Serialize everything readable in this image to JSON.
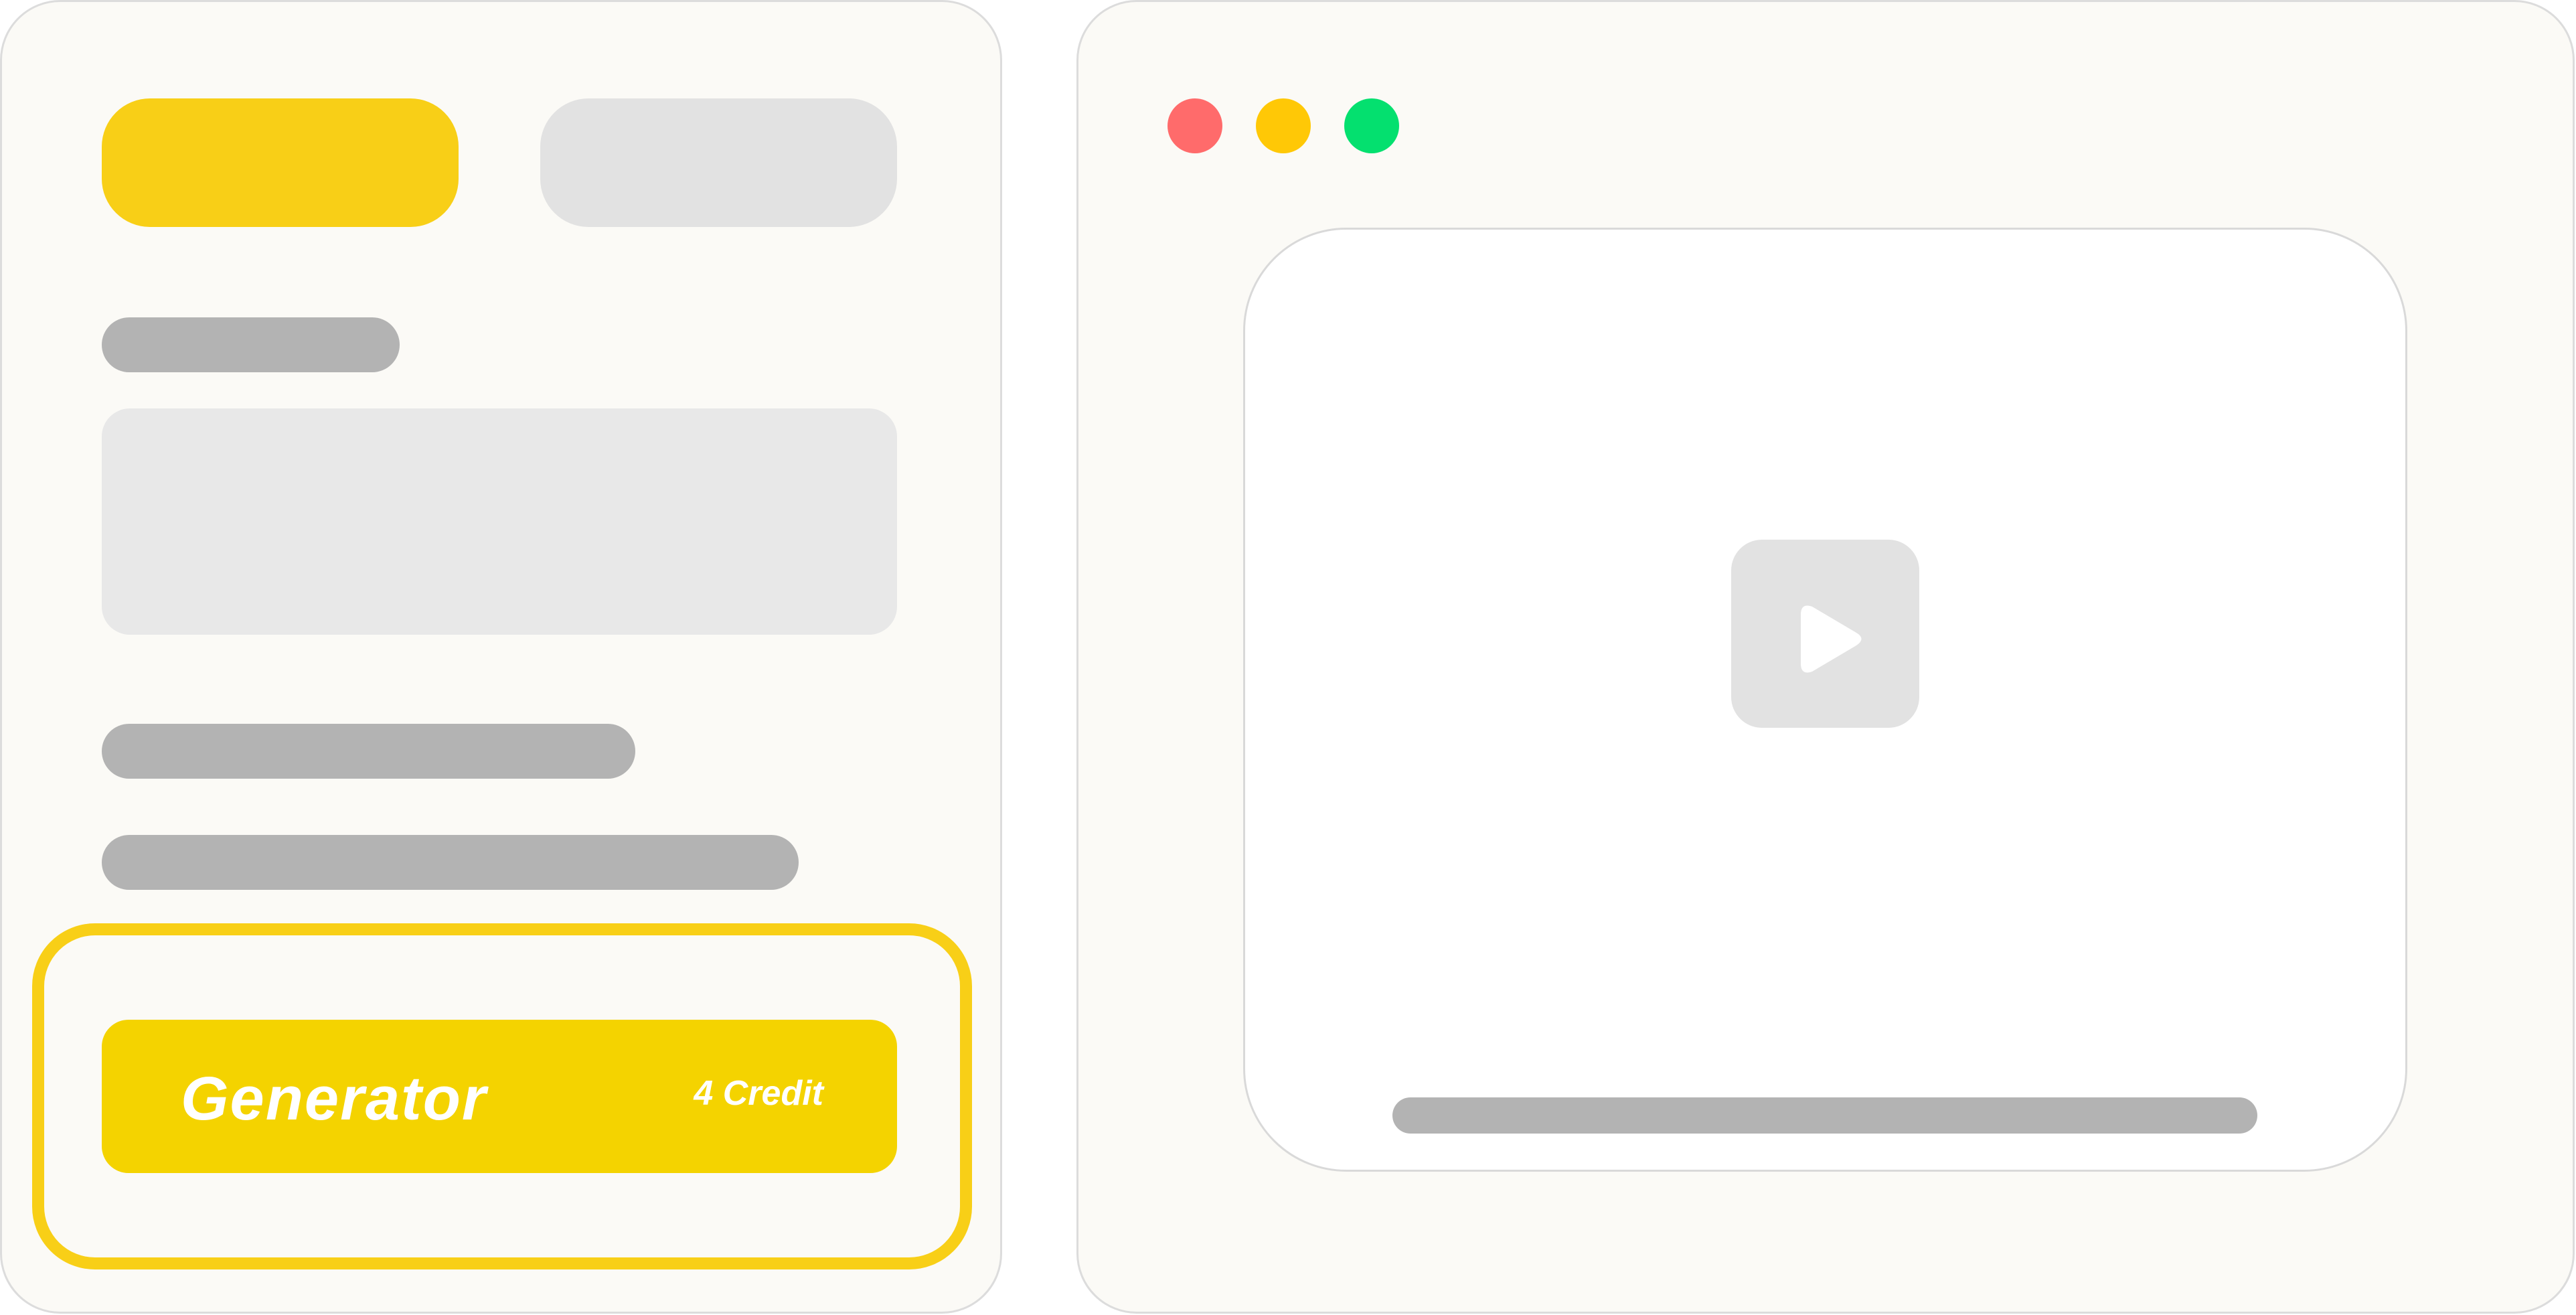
{
  "left_panel": {
    "tabs": [
      {
        "id": "tab-1",
        "state": "active"
      },
      {
        "id": "tab-2",
        "state": "inactive"
      }
    ],
    "generate_button": {
      "label": "Generator",
      "credit": "4 Credit"
    }
  },
  "right_panel": {
    "window_controls": [
      "close",
      "minimize",
      "maximize"
    ],
    "preview": {
      "icon": "play-icon"
    }
  },
  "colors": {
    "accent_yellow": "#f8cf17",
    "button_yellow": "#f4d300",
    "placeholder_gray": "#b3b3b3",
    "tab_inactive_gray": "#e2e2e2",
    "panel_bg": "#fbfaf6",
    "close_red": "#ff6b6b",
    "minimize_yellow": "#ffc806",
    "maximize_green": "#04e06f"
  }
}
